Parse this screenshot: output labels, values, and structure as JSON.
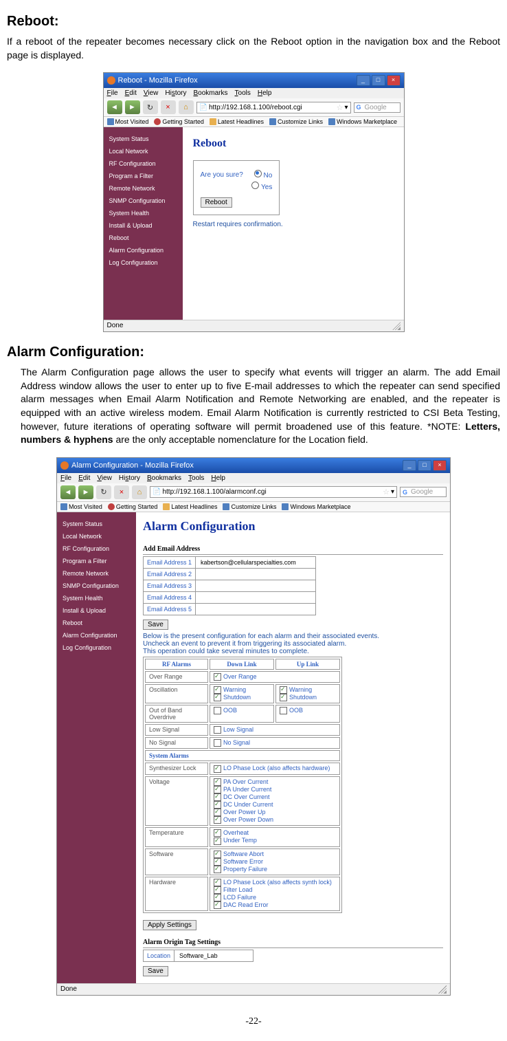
{
  "doc": {
    "heading1": "Reboot:",
    "para1": "If a reboot of the repeater becomes necessary click on the Reboot option in the navigation box and the Reboot page is displayed.",
    "heading2": "Alarm Configuration:",
    "para2a": "The Alarm Configuration page allows the user to specify what events will trigger an alarm. The add Email Address window allows the user to enter up to five E-mail addresses to which the repeater can send specified alarm messages when Email Alarm Notification and Remote Networking are enabled, and the repeater is equipped with an active wireless modem. Email Alarm Notification is currently restricted to CSI Beta Testing, however, future iterations of operating software will permit broadened use of this feature. *NOTE:  ",
    "para2b": "Letters, numbers & hyphens",
    "para2c": " are the only acceptable nomenclature for the Location field.",
    "pagenum": "-22-"
  },
  "win1": {
    "title": "Reboot - Mozilla Firefox",
    "menu": [
      "File",
      "Edit",
      "View",
      "History",
      "Bookmarks",
      "Tools",
      "Help"
    ],
    "url": "http://192.168.1.100/reboot.cgi",
    "search": "Google",
    "bookmarks": [
      "Most Visited",
      "Getting Started",
      "Latest Headlines",
      "Customize Links",
      "Windows Marketplace"
    ],
    "sidebar": [
      "System Status",
      "Local Network",
      "RF Configuration",
      "Program a Filter",
      "Remote Network",
      "SNMP Configuration",
      "System Health",
      "Install & Upload",
      "Reboot",
      "Alarm Configuration",
      "Log Configuration"
    ],
    "page_title": "Reboot",
    "prompt": "Are you sure?",
    "opt_no": "No",
    "opt_yes": "Yes",
    "btn": "Reboot",
    "note": "Restart requires confirmation.",
    "status": "Done"
  },
  "win2": {
    "title": "Alarm Configuration - Mozilla Firefox",
    "menu": [
      "File",
      "Edit",
      "View",
      "History",
      "Bookmarks",
      "Tools",
      "Help"
    ],
    "url": "http://192.168.1.100/alarmconf.cgi",
    "search": "Google",
    "bookmarks": [
      "Most Visited",
      "Getting Started",
      "Latest Headlines",
      "Customize Links",
      "Windows Marketplace"
    ],
    "sidebar": [
      "System Status",
      "Local Network",
      "RF Configuration",
      "Program a Filter",
      "Remote Network",
      "SNMP Configuration",
      "System Health",
      "Install & Upload",
      "Reboot",
      "Alarm Configuration",
      "Log Configuration"
    ],
    "page_title": "Alarm Configuration",
    "sec_email": "Add Email Address",
    "email_labels": [
      "Email Address 1",
      "Email Address 2",
      "Email Address 3",
      "Email Address 4",
      "Email Address 5"
    ],
    "email_values": [
      "kabertson@cellularspecialties.com",
      "",
      "",
      "",
      ""
    ],
    "btn_save": "Save",
    "note1": "Below is the present configuration for each alarm and their associated events.",
    "note2": "Uncheck an event to prevent it from triggering its associated alarm.",
    "note3": "This operation could take several minutes to complete.",
    "rf_hdr": [
      "RF Alarms",
      "Down Link",
      "Up Link"
    ],
    "rf_rows": [
      {
        "label": "Over Range",
        "dl": [
          [
            "Over Range",
            true
          ]
        ],
        "ul": []
      },
      {
        "label": "Oscillation",
        "dl": [
          [
            "Warning",
            true
          ],
          [
            "Shutdown",
            true
          ]
        ],
        "ul": [
          [
            "Warning",
            true
          ],
          [
            "Shutdown",
            true
          ]
        ]
      },
      {
        "label": "Out of Band Overdrive",
        "dl": [
          [
            "OOB",
            false
          ]
        ],
        "ul": [
          [
            "OOB",
            false
          ]
        ]
      },
      {
        "label": "Low Signal",
        "dl": [
          [
            "Low Signal",
            false
          ]
        ],
        "ul": []
      },
      {
        "label": "No Signal",
        "dl": [
          [
            "No Signal",
            false
          ]
        ],
        "ul": []
      }
    ],
    "sys_hdr": "System Alarms",
    "sys_rows": [
      {
        "label": "Synthesizer Lock",
        "items": [
          [
            "LO Phase Lock (also affects hardware)",
            true
          ]
        ]
      },
      {
        "label": "Voltage",
        "items": [
          [
            "PA Over Current",
            true
          ],
          [
            "PA Under Current",
            true
          ],
          [
            "DC Over Current",
            true
          ],
          [
            "DC Under Current",
            true
          ],
          [
            "Over Power Up",
            true
          ],
          [
            "Over Power Down",
            true
          ]
        ]
      },
      {
        "label": "Temperature",
        "items": [
          [
            "Overheat",
            true
          ],
          [
            "Under Temp",
            true
          ]
        ]
      },
      {
        "label": "Software",
        "items": [
          [
            "Software Abort",
            true
          ],
          [
            "Software Error",
            true
          ],
          [
            "Property Failure",
            true
          ]
        ]
      },
      {
        "label": "Hardware",
        "items": [
          [
            "LO Phase Lock (also affects synth lock)",
            true
          ],
          [
            "Filter Load",
            true
          ],
          [
            "LCD Failure",
            true
          ],
          [
            "DAC Read Error",
            true
          ]
        ]
      }
    ],
    "btn_apply": "Apply Settings",
    "sec_tag": "Alarm Origin Tag Settings",
    "loc_label": "Location",
    "loc_value": "Software_Lab",
    "status": "Done"
  }
}
